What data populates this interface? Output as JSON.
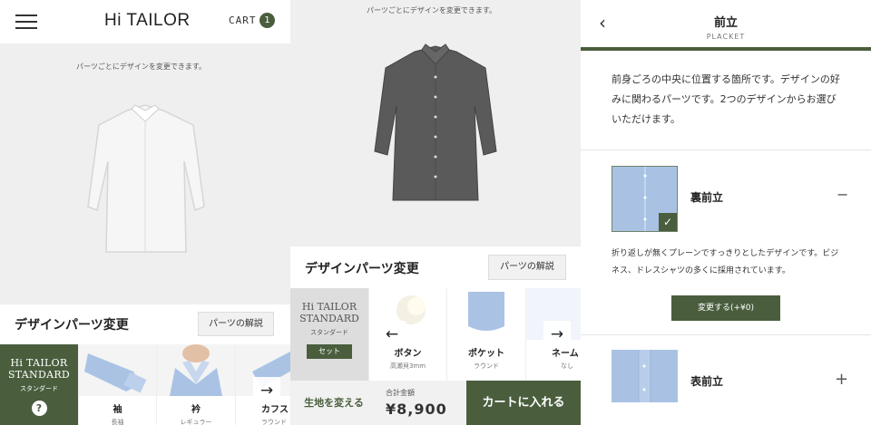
{
  "colors": {
    "brand": "#4a5e3e",
    "fabric_blue": "#a9c2e4"
  },
  "header": {
    "logo": "Hi TAILOR",
    "cart_label": "CART",
    "cart_count": "1"
  },
  "hint": "パーツごとにデザインを変更できます。",
  "design_section": {
    "title": "デザインパーツ変更",
    "explain_button": "パーツの解説"
  },
  "standard": {
    "title_line1": "Hi TAILOR",
    "title_line2": "STANDARD",
    "subtitle": "スタンダード",
    "set_label": "セット",
    "help": "?"
  },
  "panel1_parts": [
    {
      "name": "袖",
      "sub": "長袖",
      "icon": "sleeve-icon"
    },
    {
      "name": "衿",
      "sub": "レギュラー",
      "icon": "collar-icon"
    },
    {
      "name": "カフス",
      "sub": "ラウンド",
      "icon": "cuff-icon"
    }
  ],
  "panel2_parts": [
    {
      "name": "ボタン",
      "sub": "高瀬貝3mm",
      "icon": "button-icon"
    },
    {
      "name": "ポケット",
      "sub": "ラウンド",
      "icon": "pocket-icon"
    },
    {
      "name": "ネーム",
      "sub": "なし",
      "icon": "name-icon"
    }
  ],
  "bottom_bar": {
    "change_fabric": "生地を変える",
    "total_label": "合計金額",
    "total": "¥8,900",
    "add_to_cart": "カートに入れる"
  },
  "placket": {
    "title": "前立",
    "subtitle": "PLACKET",
    "description": "前身ごろの中央に位置する箇所です。デザインの好みに関わるパーツです。2つのデザインからお選びいただけます。",
    "options": [
      {
        "name": "裏前立",
        "toggle": "−",
        "selected": true,
        "detail": "折り返しが無くプレーンですっきりとしたデザインです。ビジネス、ドレスシャツの多くに採用されています。",
        "change_button": "変更する(+¥0)"
      },
      {
        "name": "表前立",
        "toggle": "+",
        "selected": false
      }
    ]
  }
}
